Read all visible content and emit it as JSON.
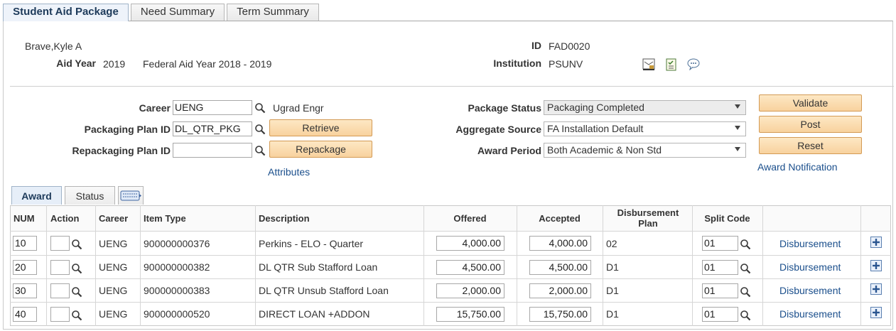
{
  "tabs": [
    {
      "label": "Student Aid Package"
    },
    {
      "label": "Need Summary"
    },
    {
      "label": "Term Summary"
    }
  ],
  "student": {
    "name": "Brave,Kyle A",
    "aid_year_label": "Aid Year",
    "aid_year": "2019",
    "aid_year_desc": "Federal Aid Year 2018 - 2019",
    "id_label": "ID",
    "id": "FAD0020",
    "institution_label": "Institution",
    "institution": "PSUNV"
  },
  "form": {
    "career_label": "Career",
    "career_value": "UENG",
    "career_desc": "Ugrad Engr",
    "plan_label": "Packaging Plan ID",
    "plan_value": "DL_QTR_PKG",
    "retrieve_label": "Retrieve",
    "repack_label": "Repackaging Plan ID",
    "repack_value": "",
    "repackage_label": "Repackage",
    "attributes_link": "Attributes",
    "status_label": "Package Status",
    "status_value": "Packaging Completed",
    "agg_label": "Aggregate Source",
    "agg_value": "FA Installation Default",
    "period_label": "Award Period",
    "period_value": "Both Academic & Non Std",
    "validate_label": "Validate",
    "post_label": "Post",
    "reset_label": "Reset",
    "notification_link": "Award Notification"
  },
  "grid_tabs": [
    {
      "label": "Award"
    },
    {
      "label": "Status"
    }
  ],
  "columns": {
    "num": "NUM",
    "action": "Action",
    "career": "Career",
    "item_type": "Item Type",
    "description": "Description",
    "offered": "Offered",
    "accepted": "Accepted",
    "disb_plan": "Disbursement Plan",
    "split_code": "Split Code"
  },
  "rows": [
    {
      "num": "10",
      "career": "UENG",
      "item_type": "900000000376",
      "description": "Perkins - ELO - Quarter",
      "offered": "4,000.00",
      "accepted": "4,000.00",
      "disb_plan": "02",
      "split_code": "01",
      "link": "Disbursement"
    },
    {
      "num": "20",
      "career": "UENG",
      "item_type": "900000000382",
      "description": "DL QTR Sub Stafford Loan",
      "offered": "4,500.00",
      "accepted": "4,500.00",
      "disb_plan": "D1",
      "split_code": "01",
      "link": "Disbursement"
    },
    {
      "num": "30",
      "career": "UENG",
      "item_type": "900000000383",
      "description": "DL QTR Unsub Stafford Loan",
      "offered": "2,000.00",
      "accepted": "2,000.00",
      "disb_plan": "D1",
      "split_code": "01",
      "link": "Disbursement"
    },
    {
      "num": "40",
      "career": "UENG",
      "item_type": "900000000520",
      "description": "DIRECT LOAN +ADDON",
      "offered": "15,750.00",
      "accepted": "15,750.00",
      "disb_plan": "D1",
      "split_code": "01",
      "link": "Disbursement"
    }
  ]
}
